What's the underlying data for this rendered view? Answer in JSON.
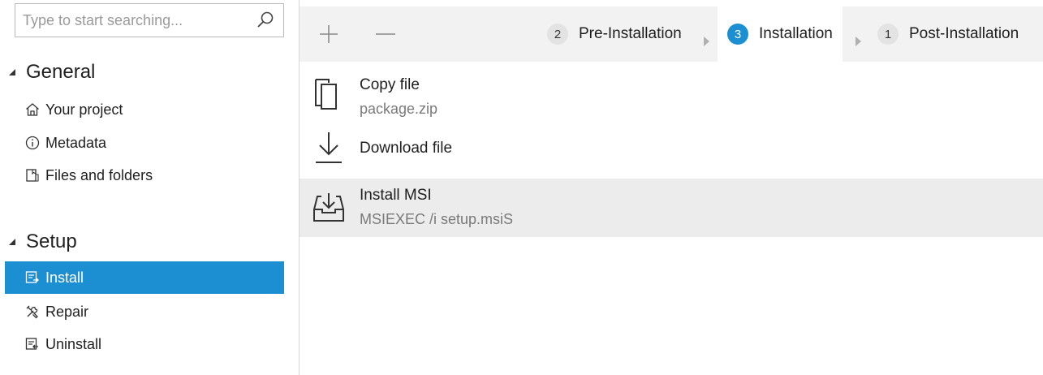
{
  "search": {
    "placeholder": "Type to start searching...",
    "value": ""
  },
  "sidebar": {
    "groups": [
      {
        "title": "General",
        "items": [
          {
            "label": "Your project",
            "icon": "home-icon"
          },
          {
            "label": "Metadata",
            "icon": "info-icon"
          },
          {
            "label": "Files and folders",
            "icon": "files-folders-icon"
          }
        ]
      },
      {
        "title": "Setup",
        "items": [
          {
            "label": "Install",
            "icon": "install-icon",
            "active": true
          },
          {
            "label": "Repair",
            "icon": "repair-icon"
          },
          {
            "label": "Uninstall",
            "icon": "uninstall-icon"
          }
        ]
      }
    ]
  },
  "toolbar": {
    "add_icon": "plus-icon",
    "remove_icon": "minus-icon",
    "steps": [
      {
        "count": "2",
        "label": "Pre-Installation"
      },
      {
        "count": "3",
        "label": "Installation",
        "active": true
      },
      {
        "count": "1",
        "label": "Post-Installation"
      }
    ]
  },
  "actions": [
    {
      "title": "Copy file",
      "subtitle": "package.zip",
      "icon": "copy-icon"
    },
    {
      "title": "Download file",
      "subtitle": "",
      "icon": "download-icon"
    },
    {
      "title": "Install MSI",
      "subtitle": "MSIEXEC /i setup.msiS",
      "icon": "install-msi-icon",
      "selected": true
    }
  ],
  "colors": {
    "accent": "#1b8fd2",
    "toolbar_bg": "#f2f2f2",
    "selected_row_bg": "#ececec"
  }
}
